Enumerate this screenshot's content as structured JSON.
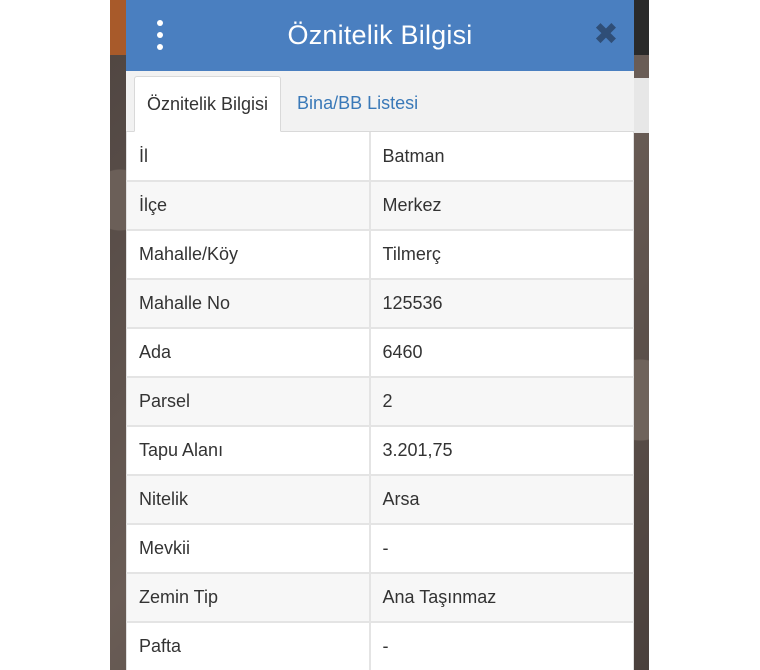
{
  "header": {
    "title": "Öznitelik Bilgisi",
    "menu_icon": "kebab-menu-icon",
    "close_icon": "close-icon",
    "close_symbol": "✖"
  },
  "tabs": [
    {
      "label": "Öznitelik Bilgisi",
      "active": true
    },
    {
      "label": "Bina/BB Listesi",
      "active": false
    }
  ],
  "attributes": [
    {
      "key": "İl",
      "value": "Batman"
    },
    {
      "key": "İlçe",
      "value": "Merkez"
    },
    {
      "key": "Mahalle/Köy",
      "value": "Tilmerç"
    },
    {
      "key": "Mahalle No",
      "value": "125536"
    },
    {
      "key": "Ada",
      "value": "6460"
    },
    {
      "key": "Parsel",
      "value": "2"
    },
    {
      "key": "Tapu Alanı",
      "value": "3.201,75"
    },
    {
      "key": "Nitelik",
      "value": "Arsa"
    },
    {
      "key": "Mevkii",
      "value": "-"
    },
    {
      "key": "Zemin Tip",
      "value": "Ana Taşınmaz"
    },
    {
      "key": "Pafta",
      "value": "-"
    }
  ],
  "colors": {
    "header_bg": "#4a7fc0",
    "tab_link": "#3a79b8",
    "close_icon": "#2f4e77"
  }
}
